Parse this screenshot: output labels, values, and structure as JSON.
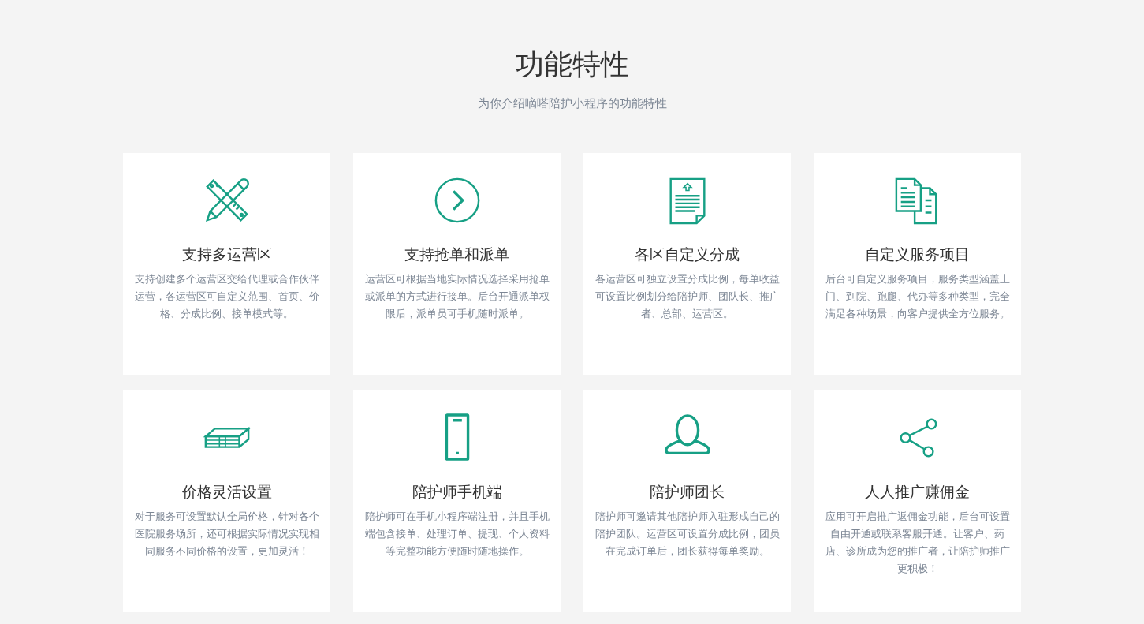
{
  "heading": "功能特性",
  "subtitle": "为你介绍嘀嗒陪护小程序的功能特性",
  "features": [
    {
      "title": "支持多运营区",
      "description": "支持创建多个运营区交给代理或合作伙伴运营，各运营区可自定义范围、首页、价格、分成比例、接单模式等。"
    },
    {
      "title": "支持抢单和派单",
      "description": "运营区可根据当地实际情况选择采用抢单或派单的方式进行接单。后台开通派单权限后，派单员可手机随时派单。"
    },
    {
      "title": "各区自定义分成",
      "description": "各运营区可独立设置分成比例，每单收益可设置比例划分给陪护师、团队长、推广者、总部、运营区。"
    },
    {
      "title": "自定义服务项目",
      "description": "后台可自定义服务项目，服务类型涵盖上门、到院、跑腿、代办等多种类型，完全满足各种场景，向客户提供全方位服务。"
    },
    {
      "title": "价格灵活设置",
      "description": "对于服务可设置默认全局价格，针对各个医院服务场所，还可根据实际情况实现相同服务不同价格的设置，更加灵活！"
    },
    {
      "title": "陪护师手机端",
      "description": "陪护师可在手机小程序端注册，并且手机端包含接单、处理订单、提现、个人资料等完整功能方便随时随地操作。"
    },
    {
      "title": "陪护师团长",
      "description": "陪护师可邀请其他陪护师入驻形成自己的陪护团队。运营区可设置分成比例，团员在完成订单后，团长获得每单奖励。"
    },
    {
      "title": "人人推广赚佣金",
      "description": "应用可开启推广返佣金功能，后台可设置自由开通或联系客服开通。让客户、药店、诊所成为您的推广者，让陪护师推广更积极！"
    }
  ]
}
